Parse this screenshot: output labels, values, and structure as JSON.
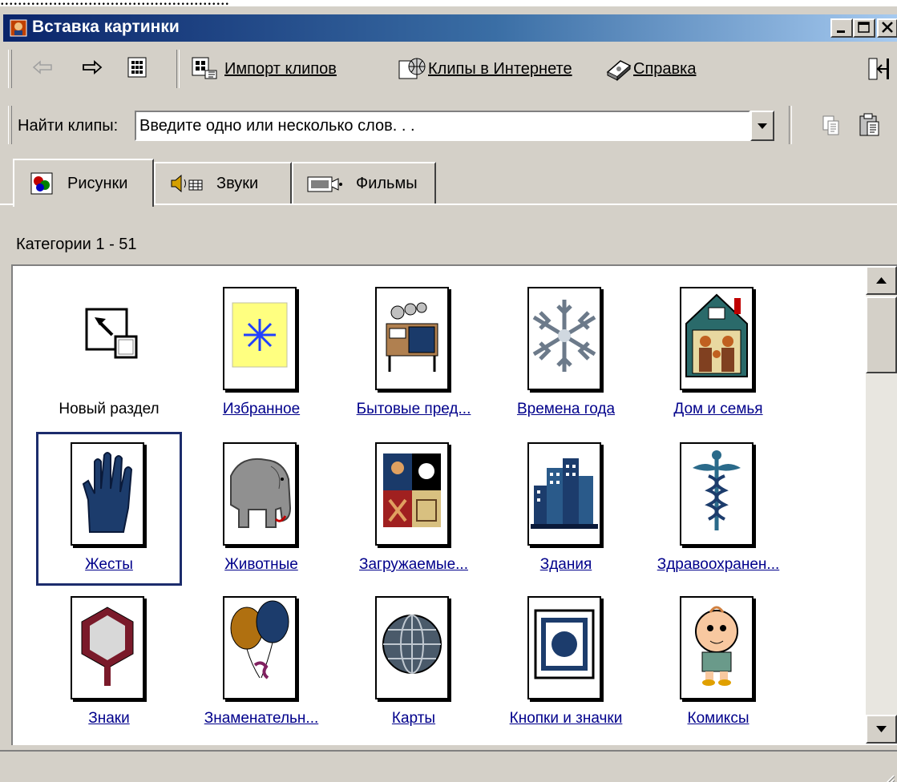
{
  "window": {
    "title": "Вставка картинки",
    "controls": [
      "minimize",
      "maximize",
      "close"
    ]
  },
  "toolbar": {
    "back_icon": "arrow-left-icon",
    "forward_icon": "arrow-right-icon",
    "import_label": "Импорт клипов",
    "online_label": "Клипы в Интернете",
    "help_label": "Справка"
  },
  "search": {
    "label": "Найти клипы:",
    "value": "Введите одно или несколько слов. . ."
  },
  "tabs": [
    {
      "label": "Рисунки",
      "active": true
    },
    {
      "label": "Звуки",
      "active": false
    },
    {
      "label": "Фильмы",
      "active": false
    }
  ],
  "categories_count": "Категории 1 - 51",
  "categories": [
    {
      "label": "Новый раздел",
      "icon": "new-category-icon",
      "link": false
    },
    {
      "label": "Избранное",
      "icon": "favorites-star-icon",
      "link": true
    },
    {
      "label": "Бытовые пред...",
      "icon": "household-items-icon",
      "link": true
    },
    {
      "label": "Времена года",
      "icon": "snowflake-icon",
      "link": true
    },
    {
      "label": "Дом и семья",
      "icon": "house-family-icon",
      "link": true
    },
    {
      "label": "Жесты",
      "icon": "hand-icon",
      "link": true,
      "selected": true
    },
    {
      "label": "Животные",
      "icon": "elephant-icon",
      "link": true
    },
    {
      "label": "Загружаемые...",
      "icon": "downloaded-clips-icon",
      "link": true
    },
    {
      "label": "Здания",
      "icon": "buildings-icon",
      "link": true
    },
    {
      "label": "Здравоохранен...",
      "icon": "caduceus-icon",
      "link": true
    },
    {
      "label": "Знаки",
      "icon": "road-sign-icon",
      "link": true
    },
    {
      "label": "Знаменательн...",
      "icon": "balloons-icon",
      "link": true
    },
    {
      "label": "Карты",
      "icon": "globe-icon",
      "link": true
    },
    {
      "label": "Кнопки и значки",
      "icon": "button-icon",
      "link": true
    },
    {
      "label": "Комиксы",
      "icon": "cartoon-kid-icon",
      "link": true
    }
  ]
}
